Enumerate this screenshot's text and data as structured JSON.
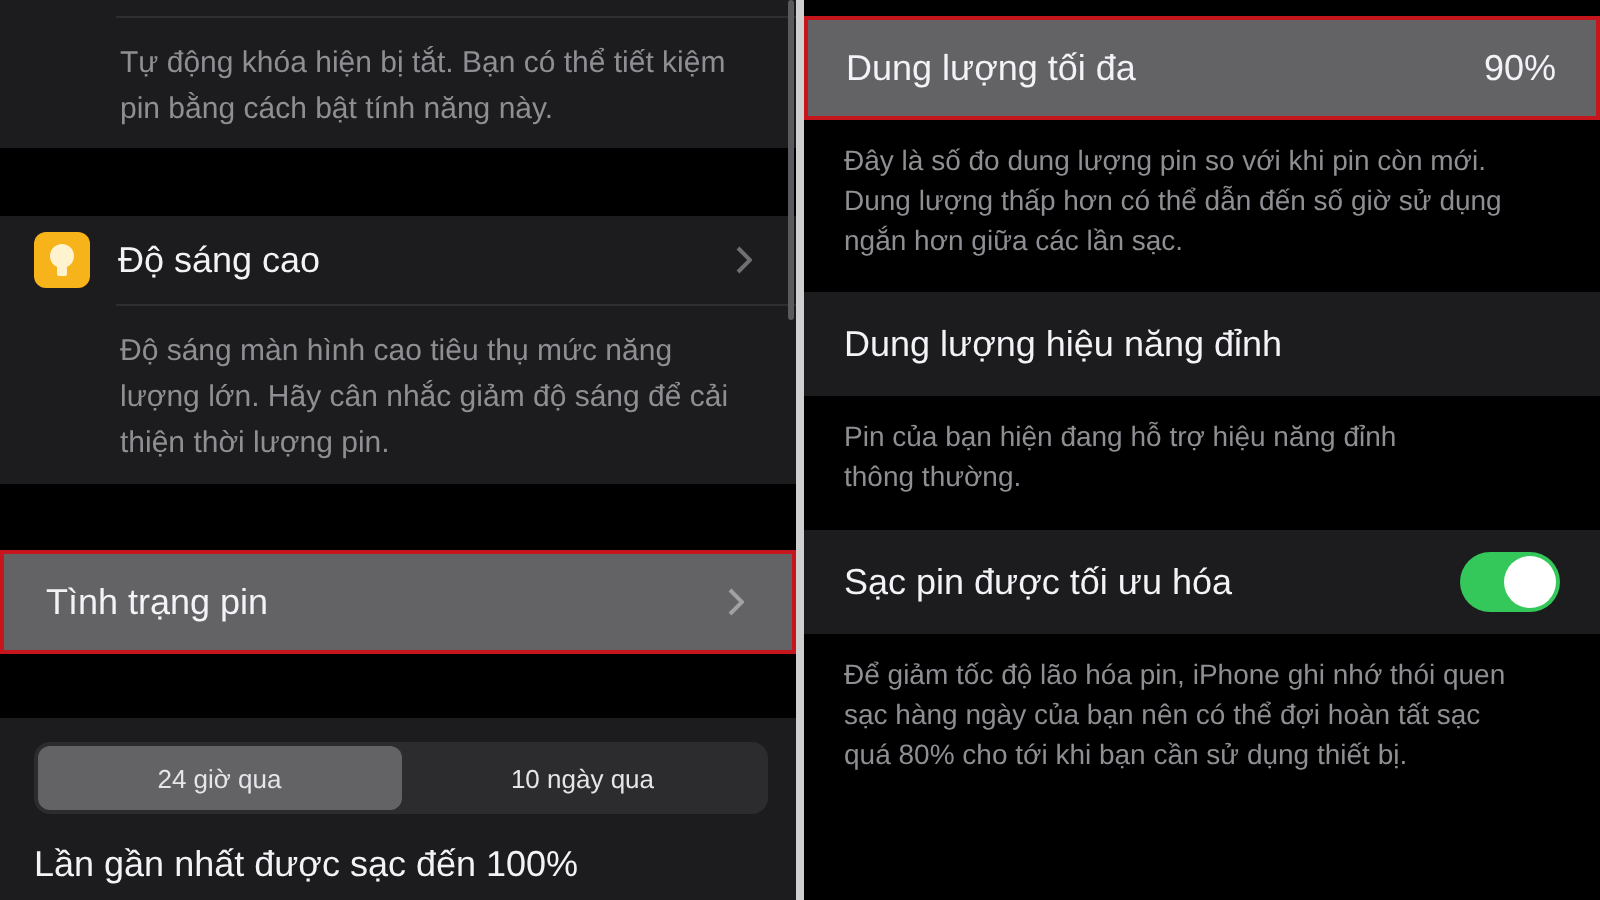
{
  "left": {
    "top_note": "Tự động khóa hiện bị tắt. Bạn có thể tiết kiệm\npin bằng cách bật tính năng này.",
    "brightness": {
      "title": "Độ sáng cao",
      "note": "Độ sáng màn hình cao tiêu thụ mức năng\nlượng lớn. Hãy cân nhắc giảm độ sáng để cải\nthiện thời lượng pin."
    },
    "battery_health": {
      "label": "Tình trạng pin",
      "highlighted": true
    },
    "segments": [
      {
        "label": "24 giờ qua",
        "selected": true
      },
      {
        "label": "10 ngày qua",
        "selected": false
      }
    ],
    "last_charged": "Lần gần nhất được sạc đến 100%"
  },
  "right": {
    "max_capacity": {
      "label": "Dung lượng tối đa",
      "value": "90%",
      "highlighted": true,
      "note": "Đây là số đo dung lượng pin so với khi pin còn mới.\nDung lượng thấp hơn có thể dẫn đến số giờ sử dụng\nngắn hơn giữa các lần sạc."
    },
    "peak": {
      "label": "Dung lượng hiệu năng đỉnh",
      "note": "Pin của bạn hiện đang hỗ trợ hiệu năng đỉnh\nthông thường."
    },
    "optimized": {
      "label": "Sạc pin được tối ưu hóa",
      "on": true,
      "note": "Để giảm tốc độ lão hóa pin, iPhone ghi nhớ thói quen\nsạc hàng ngày của bạn nên có thể đợi hoàn tất sạc\nquá 80% cho tới khi bạn cần sử dụng thiết bị."
    }
  }
}
